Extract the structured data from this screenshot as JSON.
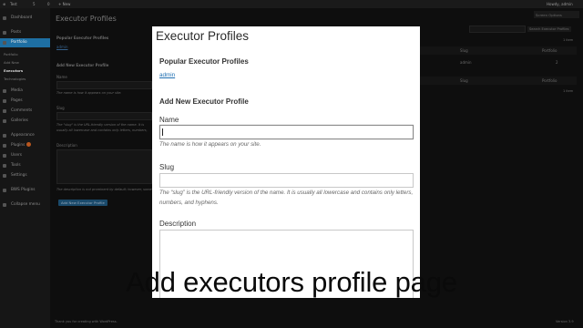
{
  "adminbar": {
    "site": "Test",
    "updates": "5",
    "comments": "0",
    "new": "+ New",
    "howdy": "Howdy, admin"
  },
  "sidebar": {
    "items": [
      {
        "label": "Dashboard"
      },
      {
        "label": "Posts"
      },
      {
        "label": "Portfolio"
      },
      {
        "label": "Media"
      },
      {
        "label": "Pages"
      },
      {
        "label": "Comments"
      },
      {
        "label": "Galleries"
      },
      {
        "label": "Appearance"
      },
      {
        "label": "Plugins"
      },
      {
        "label": "Users"
      },
      {
        "label": "Tools"
      },
      {
        "label": "Settings"
      },
      {
        "label": "BWS Plugins"
      },
      {
        "label": "Collapse menu"
      }
    ],
    "submenu": [
      "Portfolio",
      "Add New",
      "Executors",
      "Technologies"
    ]
  },
  "background": {
    "page_title": "Executor Profiles",
    "screen_options": "Screen Options",
    "popular": "Popular Executor Profiles",
    "popular_link": "admin",
    "add_new": "Add New Executor Profile",
    "name_label": "Name",
    "name_help": "The name is how it appears on your site.",
    "slug_label": "Slug",
    "slug_help": "The \"slug\" is the URL-friendly version of the name. It is usually all lowercase and contains only letters, numbers, and hyphens.",
    "desc_label": "Description",
    "desc_help": "The description is not prominent by default; however, some themes may show it.",
    "add_button": "Add New Executor Profile",
    "search_button": "Search Executor Profiles",
    "items_count": "1 item",
    "col_slug": "Slug",
    "col_portfolio": "Portfolio",
    "row_slug": "admin",
    "row_count": "2",
    "footer_left": "Thank you for creating with WordPress.",
    "footer_right": "Version 3.9"
  },
  "modal": {
    "title": "Executor Profiles",
    "popular_heading": "Popular Executor Profiles",
    "popular_link": "admin",
    "add_heading": "Add New Executor Profile",
    "name_label": "Name",
    "name_value": "",
    "name_help": "The name is how it appears on your site.",
    "slug_label": "Slug",
    "slug_value": "",
    "slug_help": "The “slug” is the URL-friendly version of the name. It is usually all lowercase and contains only letters, numbers, and hyphens.",
    "description_label": "Description",
    "description_value": ""
  },
  "caption": "Add executors profile page"
}
